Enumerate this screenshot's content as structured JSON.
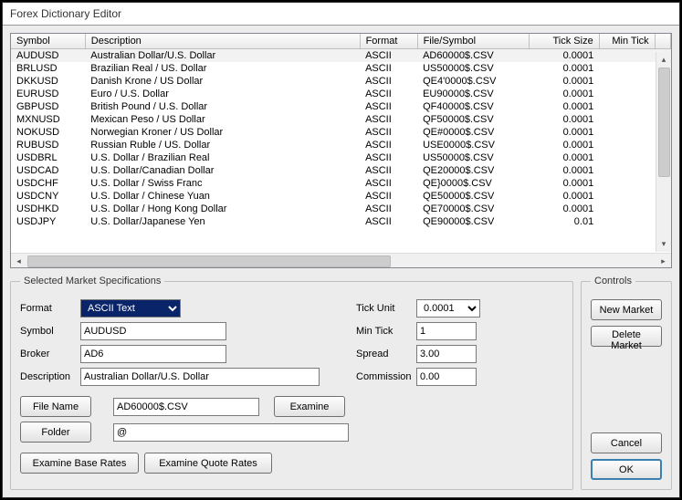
{
  "window": {
    "title": "Forex Dictionary Editor"
  },
  "table": {
    "headers": {
      "symbol": "Symbol",
      "description": "Description",
      "format": "Format",
      "file": "File/Symbol",
      "tick": "Tick Size",
      "mintick": "Min Tick"
    },
    "rows": [
      {
        "symbol": "AUDUSD",
        "description": "Australian Dollar/U.S. Dollar",
        "format": "ASCII",
        "file": "AD60000$.CSV",
        "tick": "0.0001"
      },
      {
        "symbol": "BRLUSD",
        "description": "Brazilian Real / US. Dollar",
        "format": "ASCII",
        "file": "US50000$.CSV",
        "tick": "0.0001"
      },
      {
        "symbol": "DKKUSD",
        "description": "Danish Krone / US Dollar",
        "format": "ASCII",
        "file": "QE4'0000$.CSV",
        "tick": "0.0001"
      },
      {
        "symbol": "EURUSD",
        "description": "Euro / U.S. Dollar",
        "format": "ASCII",
        "file": "EU90000$.CSV",
        "tick": "0.0001"
      },
      {
        "symbol": "GBPUSD",
        "description": "British Pound / U.S. Dollar",
        "format": "ASCII",
        "file": "QF40000$.CSV",
        "tick": "0.0001"
      },
      {
        "symbol": "MXNUSD",
        "description": "Mexican Peso / US Dollar",
        "format": "ASCII",
        "file": "QF50000$.CSV",
        "tick": "0.0001"
      },
      {
        "symbol": "NOKUSD",
        "description": "Norwegian Kroner / US Dollar",
        "format": "ASCII",
        "file": "QE#0000$.CSV",
        "tick": "0.0001"
      },
      {
        "symbol": "RUBUSD",
        "description": "Russian Ruble / US. Dollar",
        "format": "ASCII",
        "file": "USE0000$.CSV",
        "tick": "0.0001"
      },
      {
        "symbol": "USDBRL",
        "description": "U.S. Dollar / Brazilian Real",
        "format": "ASCII",
        "file": "US50000$.CSV",
        "tick": "0.0001"
      },
      {
        "symbol": "USDCAD",
        "description": "U.S. Dollar/Canadian Dollar",
        "format": "ASCII",
        "file": "QE20000$.CSV",
        "tick": "0.0001"
      },
      {
        "symbol": "USDCHF",
        "description": "U.S. Dollar / Swiss Franc",
        "format": "ASCII",
        "file": "QE}0000$.CSV",
        "tick": "0.0001"
      },
      {
        "symbol": "USDCNY",
        "description": "U.S. Dollar / Chinese Yuan",
        "format": "ASCII",
        "file": "QE50000$.CSV",
        "tick": "0.0001"
      },
      {
        "symbol": "USDHKD",
        "description": "U.S. Dollar / Hong Kong Dollar",
        "format": "ASCII",
        "file": "QE70000$.CSV",
        "tick": "0.0001"
      },
      {
        "symbol": "USDJPY",
        "description": "U.S. Dollar/Japanese Yen",
        "format": "ASCII",
        "file": "QE90000$.CSV",
        "tick": "0.01"
      }
    ]
  },
  "specs": {
    "legend": "Selected Market Specifications",
    "labels": {
      "format": "Format",
      "symbol": "Symbol",
      "broker": "Broker",
      "description": "Description",
      "tickunit": "Tick Unit",
      "mintick": "Min Tick",
      "spread": "Spread",
      "commission": "Commission",
      "filename": "File Name",
      "folder": "Folder",
      "examine": "Examine",
      "ebr": "Examine Base Rates",
      "eqr": "Examine  Quote Rates"
    },
    "values": {
      "format": "ASCII Text",
      "symbol": "AUDUSD",
      "broker": "AD6",
      "description": "Australian Dollar/U.S. Dollar",
      "tickunit": "0.0001",
      "mintick": "1",
      "spread": "3.00",
      "commission": "0.00",
      "filename": "AD60000$.CSV",
      "folder": "@"
    }
  },
  "controls": {
    "legend": "Controls",
    "newmarket": "New Market",
    "deletemarket": "Delete Market",
    "cancel": "Cancel",
    "ok": "OK"
  }
}
